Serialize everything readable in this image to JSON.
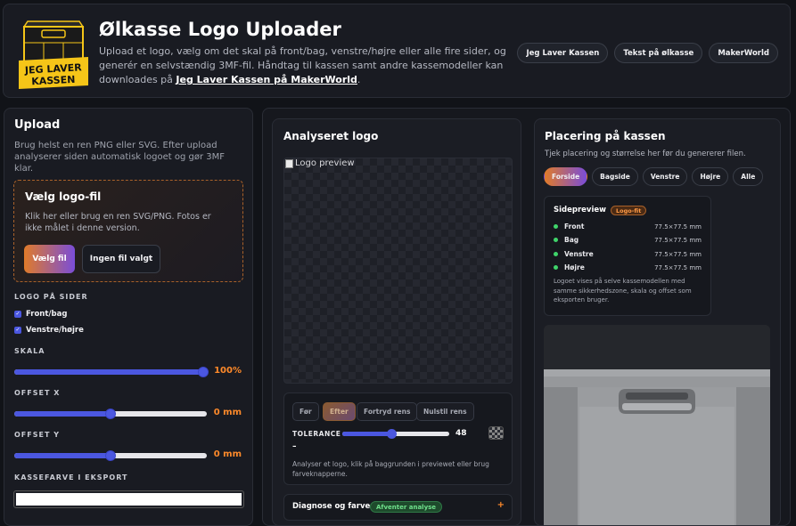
{
  "header": {
    "title": "Ølkasse Logo Uploader",
    "desc_text": "Upload et logo, vælg om det skal på front/bag, venstre/højre eller alle fire sider, og generér en selvstændig 3MF-fil. Håndtag til kassen samt andre kassemodeller kan downloades på ",
    "desc_link": "Jeg Laver Kassen på MakerWorld",
    "desc_end": ".",
    "logo_line1": "JEG LAVER",
    "logo_line2": "KASSEN",
    "links": [
      "Jeg Laver Kassen",
      "Tekst på ølkasse",
      "MakerWorld"
    ]
  },
  "upload": {
    "title": "Upload",
    "desc": "Brug helst en ren PNG eller SVG. Efter upload analyserer siden automatisk logoet og gør 3MF klar.",
    "drop_title": "Vælg logo-fil",
    "drop_desc": "Klik her eller brug en ren SVG/PNG. Fotos er ikke målet i denne version.",
    "choose_btn": "Vælg fil",
    "no_file_btn": "Ingen fil valgt",
    "sides_label": "LOGO PÅ SIDER",
    "check_front": "Front/bag",
    "check_sides": "Venstre/højre",
    "scale_label": "SKALA",
    "scale_value": "100%",
    "scale_fraction": 1.0,
    "offset_x_label": "OFFSET X",
    "offset_x_value": "0 mm",
    "offset_y_label": "OFFSET Y",
    "offset_y_value": "0 mm",
    "color_label": "KASSEFARVE I EKSPORT",
    "color_value": "#ffffff"
  },
  "analysis": {
    "title": "Analyseret logo",
    "img_alt": "Logo preview",
    "btn_before": "Før",
    "btn_after": "Efter",
    "btn_undo": "Fortryd rens",
    "btn_reset": "Nulstil rens",
    "tolerance_label": "TOLERANCE",
    "tolerance_value": "48",
    "tolerance_dash": "–",
    "hint": "Analyser et logo, klik på baggrunden i previewet eller brug farveknapperne.",
    "diag_title": "Diagnose og farver",
    "diag_badge": "Afventer analyse",
    "diag_toggle": "+"
  },
  "placement": {
    "title": "Placering på kassen",
    "desc": "Tjek placering og størrelse her før du genererer filen.",
    "tabs": [
      "Forside",
      "Bagside",
      "Venstre",
      "Højre",
      "Alle"
    ],
    "card_title": "Sidepreview",
    "card_badge": "Logo-fit",
    "sides": [
      {
        "name": "Front",
        "dim": "77.5×77.5 mm"
      },
      {
        "name": "Bag",
        "dim": "77.5×77.5 mm"
      },
      {
        "name": "Venstre",
        "dim": "77.5×77.5 mm"
      },
      {
        "name": "Højre",
        "dim": "77.5×77.5 mm"
      }
    ],
    "card_note": "Logoet vises på selve kassemodellen med samme sikkerhedszone, skala og offset som eksporten bruger."
  },
  "colors": {
    "accent_orange": "#ff8a2a",
    "accent_blue": "#4b57e0",
    "status_green": "#3fd46a"
  }
}
